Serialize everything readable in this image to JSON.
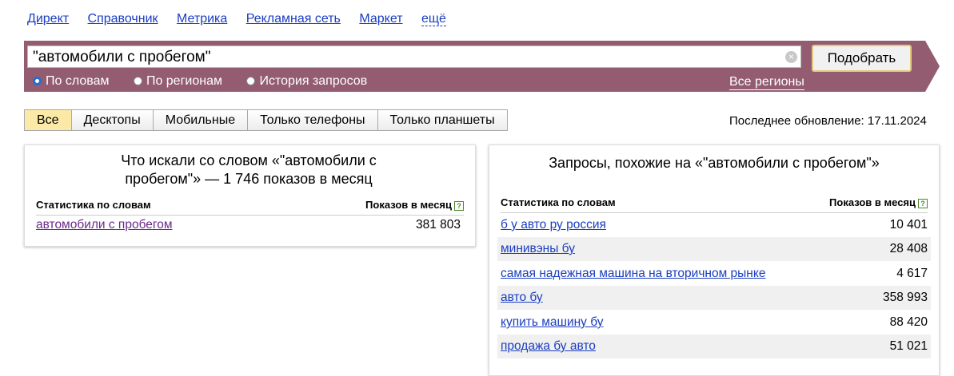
{
  "nav": [
    "Директ",
    "Справочник",
    "Метрика",
    "Рекламная сеть",
    "Маркет",
    "ещё"
  ],
  "search": {
    "query": "\"автомобили с пробегом\"",
    "clear_glyph": "×",
    "submit": "Подобрать"
  },
  "radios": [
    {
      "label": "По словам",
      "selected": true
    },
    {
      "label": "По регионам",
      "selected": false
    },
    {
      "label": "История запросов",
      "selected": false
    }
  ],
  "regions_link": "Все регионы",
  "tabs": [
    "Все",
    "Десктопы",
    "Мобильные",
    "Только телефоны",
    "Только планшеты"
  ],
  "updated": "Последнее обновление: 17.11.2024",
  "left_panel": {
    "title": "Что искали со словом «\"автомобили с пробегом\"» — 1 746 показов в месяц",
    "col_stat": "Статистика по словам",
    "col_count": "Показов в месяц",
    "help": "?",
    "rows": [
      {
        "phrase": "автомобили с пробегом",
        "count": "381 803"
      }
    ]
  },
  "right_panel": {
    "title": "Запросы, похожие на «\"автомобили с пробегом\"»",
    "col_stat": "Статистика по словам",
    "col_count": "Показов в месяц",
    "help": "?",
    "rows": [
      {
        "phrase": "б у авто ру россия",
        "count": "10 401"
      },
      {
        "phrase": "минивэны бу",
        "count": "28 408"
      },
      {
        "phrase": "самая надежная машина на вторичном рынке",
        "count": "4 617"
      },
      {
        "phrase": "авто бу",
        "count": "358 993"
      },
      {
        "phrase": "купить машину бу",
        "count": "88 420"
      },
      {
        "phrase": "продажа бу авто",
        "count": "51 021"
      }
    ]
  },
  "colors": {
    "bar": "#935c70",
    "active_tab": "#fce9a8",
    "link": "#1a3dc1"
  }
}
